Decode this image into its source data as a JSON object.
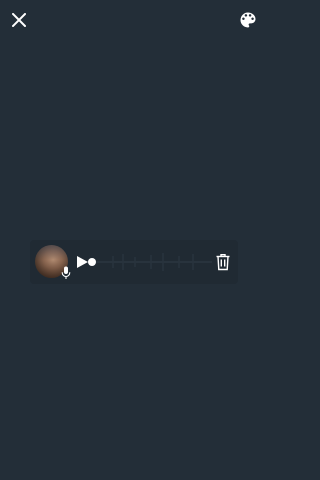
{
  "colors": {
    "background": "#232e38",
    "card": "#202a33",
    "icon": "#ffffff"
  },
  "header": {
    "close_icon": "close-icon",
    "palette_icon": "palette-icon"
  },
  "voice_message": {
    "avatar": "user-avatar-photo",
    "mic_icon": "mic-icon",
    "play_icon": "play-icon",
    "delete_icon": "trash-icon",
    "progress": 0.0
  }
}
